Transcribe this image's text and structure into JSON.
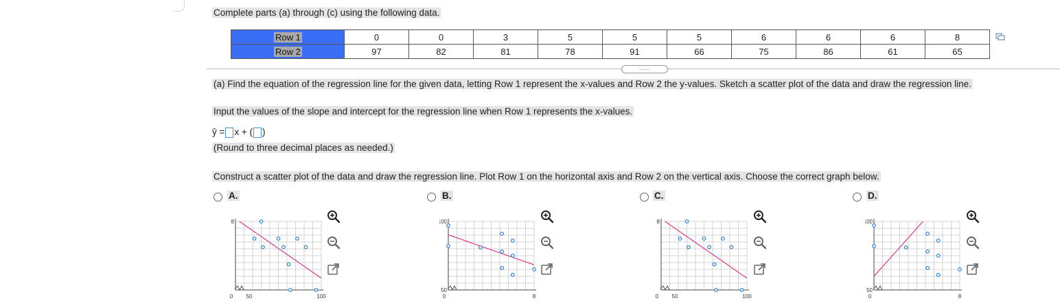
{
  "instructions": "Complete parts (a) through (c) using the following data.",
  "table": {
    "rows": [
      {
        "label": "Row 1",
        "values": [
          "0",
          "0",
          "3",
          "5",
          "5",
          "5",
          "6",
          "6",
          "6",
          "8"
        ]
      },
      {
        "label": "Row 2",
        "values": [
          "97",
          "82",
          "81",
          "78",
          "91",
          "66",
          "75",
          "86",
          "61",
          "65"
        ]
      }
    ]
  },
  "expander_label": ".....",
  "part_a": {
    "question": "(a) Find the equation of the regression line for the given data, letting Row 1 represent the x-values and Row 2 the y-values. Sketch a scatter plot of the data and draw the regression line.",
    "prompt": "Input the values of the slope and intercept for the regression line when Row 1 represents the x-values.",
    "eq_lhs": "ŷ =",
    "eq_mid": "x +",
    "eq_open": "(",
    "eq_close": ")",
    "round_note": "(Round to three decimal places as needed.)",
    "scatter_prompt": "Construct a scatter plot of the data and draw the regression line. Plot Row 1 on the horizontal axis and Row 2 on the vertical axis. Choose the correct graph below."
  },
  "options": [
    {
      "label": "A.",
      "y_tick_top": "8",
      "x_ticks": [
        "0",
        "50",
        "100"
      ]
    },
    {
      "label": "B.",
      "y_tick_top": "100",
      "y_tick_low": "50",
      "x_ticks": [
        "0",
        "8"
      ]
    },
    {
      "label": "C.",
      "y_tick_top": "8",
      "x_ticks": [
        "0",
        "50",
        "100"
      ]
    },
    {
      "label": "D.",
      "y_tick_top": "100",
      "y_tick_low": "50",
      "x_ticks": [
        "0",
        "8"
      ]
    }
  ],
  "chart_data": [
    {
      "type": "scatter",
      "x": [
        97,
        82,
        81,
        78,
        91,
        66,
        75,
        86,
        61,
        65
      ],
      "y": [
        0,
        0,
        3,
        5,
        5,
        5,
        6,
        6,
        6,
        8
      ],
      "xlim": [
        50,
        100
      ],
      "ylim": [
        0,
        8
      ],
      "regression_line": true,
      "line_color": "#e0297a",
      "point_color": "#1f77d0"
    },
    {
      "type": "scatter",
      "x": [
        0,
        0,
        3,
        5,
        5,
        5,
        6,
        6,
        6,
        8
      ],
      "y": [
        97,
        82,
        81,
        78,
        91,
        66,
        75,
        86,
        61,
        65
      ],
      "xlim": [
        0,
        8
      ],
      "ylim": [
        50,
        100
      ],
      "regression_line": true,
      "line_color": "#e0297a",
      "point_color": "#1f77d0"
    },
    {
      "type": "scatter",
      "x": [
        97,
        82,
        81,
        78,
        91,
        66,
        75,
        86,
        61,
        65
      ],
      "y": [
        0,
        0,
        3,
        5,
        5,
        5,
        6,
        6,
        6,
        8
      ],
      "xlim": [
        50,
        100
      ],
      "ylim": [
        0,
        8
      ],
      "regression_line": true,
      "line_color": "#e0297a",
      "point_color": "#1f77d0"
    },
    {
      "type": "scatter",
      "x": [
        0,
        0,
        3,
        5,
        5,
        5,
        6,
        6,
        6,
        8
      ],
      "y": [
        97,
        82,
        81,
        78,
        91,
        66,
        75,
        86,
        61,
        65
      ],
      "xlim": [
        0,
        8
      ],
      "ylim": [
        50,
        100
      ],
      "regression_line": true,
      "line_color": "#e0297a",
      "point_color": "#1f77d0"
    }
  ],
  "icons": [
    "zoom-in-icon",
    "zoom-out-icon",
    "popout-icon",
    "copy-data-icon"
  ]
}
